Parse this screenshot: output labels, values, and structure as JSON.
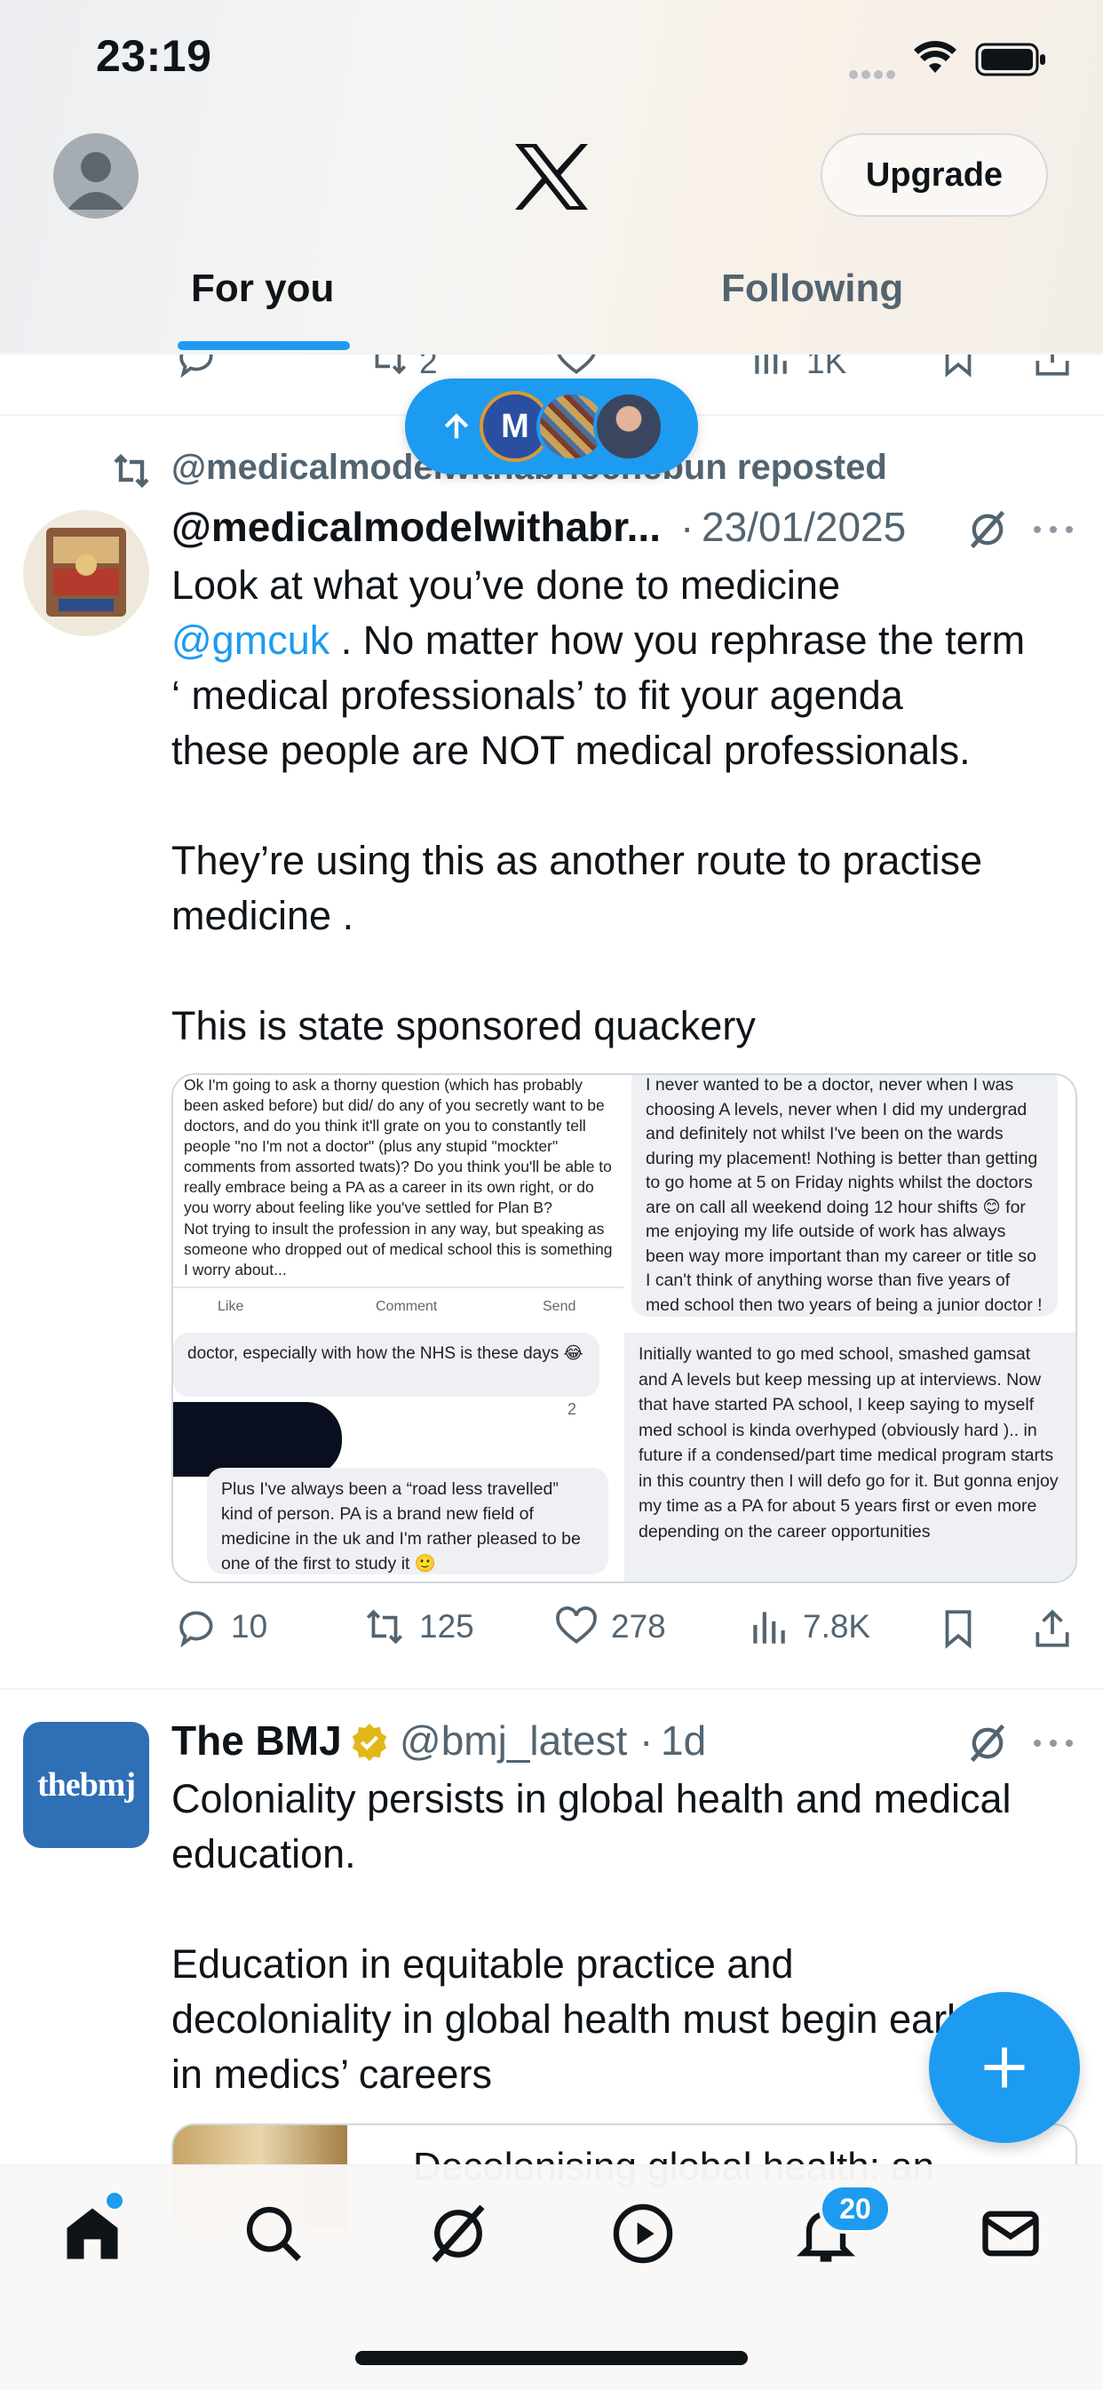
{
  "status_bar": {
    "time": "23:19"
  },
  "header": {
    "logo": "x-logo",
    "upgrade_label": "Upgrade"
  },
  "tabs": [
    {
      "label": "For you",
      "active": true
    },
    {
      "label": "Following",
      "active": false
    }
  ],
  "prev_tweet_actions": {
    "retweets": "2",
    "views": "1K"
  },
  "new_posts_pill": {
    "avatar_letter": "M"
  },
  "tweets": [
    {
      "repost_text": "@medicalmodelwithabriochebun reposted",
      "author": "@medicalmodelwithabr...",
      "separator": "·",
      "date": "23/01/2025",
      "text_line1": "Look at what you’ve done to medicine",
      "mention": "@gmcuk",
      "text_rest": " . No matter how you rephrase the term\n‘ medical professionals’ to fit your agenda\nthese people are NOT medical professionals.\n\nThey’re using this as another route to practise\nmedicine .\n\nThis is state sponsored quackery",
      "media": {
        "q1": "Ok I'm going to ask a thorny question (which has probably been asked before) but did/ do any of you secretly want to be doctors, and do you think it'll grate on you to constantly tell people \"no I'm not a doctor\" (plus any stupid \"mockter\" comments from assorted twats)? Do you think you'll be able to really embrace being a PA as a career in its own right, or do you worry about feeling like you've settled for Plan B?",
        "q2": "Not trying to insult the profession in any way, but speaking as someone who dropped out of medical school this is something I worry about...",
        "like": "Like",
        "comment": "Comment",
        "send": "Send",
        "r1": "doctor, especially with how the NHS is these days 😂",
        "r1_count": "2",
        "r2": "Plus I've always been a “road less travelled” kind of person. PA is a brand new field of medicine in the uk and I'm rather pleased to be one of the first to study it 🙂",
        "right_top": "I never wanted to be a doctor, never when I was choosing A levels, never when I did my undergrad and definitely not whilst I've been on the wards during my placement! Nothing is better than getting to go home at 5 on Friday nights whilst the doctors are on call all weekend doing 12 hour shifts 😊 for me enjoying my life outside of work has always been way more important than my career or title so I can't think of anything worse than five years of med school then two years of being a junior doctor !",
        "right_bottom": "Initially wanted to go med school, smashed gamsat and A levels but keep messing up at interviews. Now that have started PA school, I keep saying to myself med school is kinda overhyped (obviously hard ).. in future if a condensed/part time medical program starts in this country then I will defo go for it. But gonna enjoy my time as a PA for about 5 years first or even more depending on the career opportunities"
      },
      "replies": "10",
      "retweets": "125",
      "likes": "278",
      "views": "7.8K"
    },
    {
      "author": "The BMJ",
      "handle": "@bmj_latest",
      "separator": "·",
      "date": "1d",
      "avatar_text": "thebmj",
      "text": "Coloniality persists in global health and medical\neducation.\n\nEducation in equitable practice and\ndecoloniality in global health must begin early\nin medics’ careers",
      "card_title": "Decolonising global health: an"
    }
  ],
  "bottom_nav": {
    "notifications_count": "20"
  },
  "colors": {
    "accent": "#1d9bf0",
    "text": "#0f1419",
    "secondary": "#536471"
  }
}
